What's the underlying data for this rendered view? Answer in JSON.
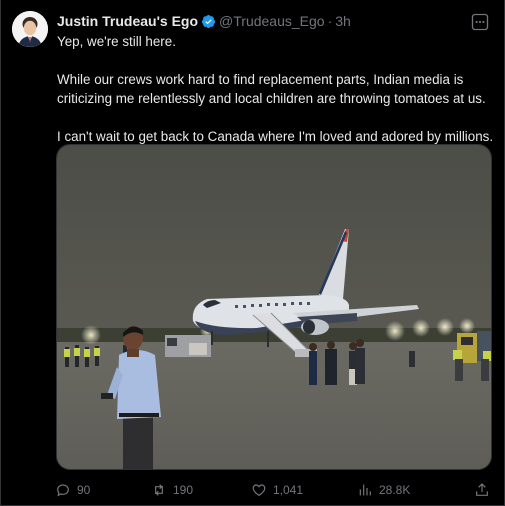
{
  "author": {
    "display_name": "Justin Trudeau's Ego",
    "handle": "@Trudeaus_Ego",
    "separator": "·",
    "time": "3h"
  },
  "tweet_text": [
    "Yep, we're still here.",
    "While our crews work hard to find replacement parts, Indian media is criticizing me relentlessly and local children are throwing tomatoes at us.",
    "I can't wait to get back to Canada where I'm loved and adored by millions."
  ],
  "icons": {
    "verified": "verified-badge-icon",
    "more": "more-options-icon",
    "reply": "reply-icon",
    "retweet": "retweet-icon",
    "like": "like-icon",
    "views": "views-icon",
    "share": "share-icon"
  },
  "actions": {
    "replies": "90",
    "retweets": "190",
    "likes": "1,041",
    "views": "28.8K"
  },
  "colors": {
    "background": "#000000",
    "text": "#e7e9ea",
    "muted": "#71767b",
    "verified_blue": "#1d9bf0"
  }
}
